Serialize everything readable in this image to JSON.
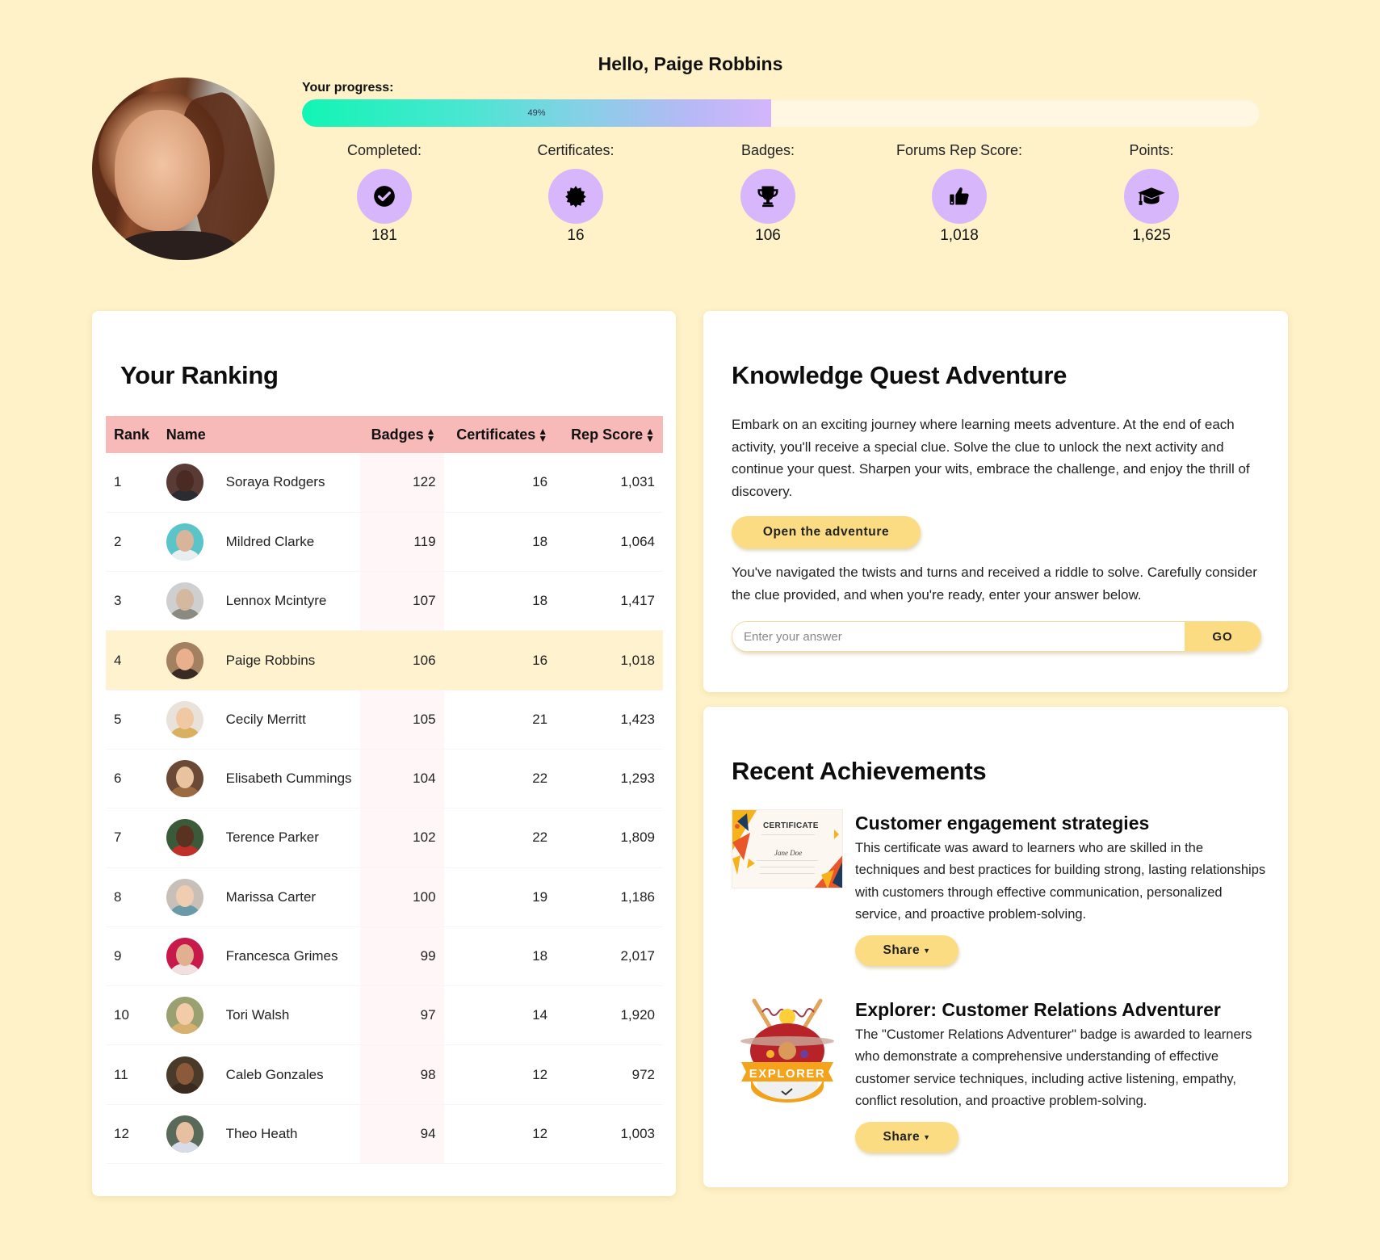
{
  "header": {
    "greeting": "Hello, Paige Robbins",
    "progress_label": "Your progress:",
    "progress_percent": 49,
    "progress_text": "49%",
    "avatar_alt": "Paige Robbins profile photo"
  },
  "stats": [
    {
      "label": "Completed:",
      "value": "181",
      "icon": "check-circle-icon"
    },
    {
      "label": "Certificates:",
      "value": "16",
      "icon": "certificate-seal-icon"
    },
    {
      "label": "Badges:",
      "value": "106",
      "icon": "trophy-icon"
    },
    {
      "label": "Forums Rep Score:",
      "value": "1,018",
      "icon": "thumbs-up-icon"
    },
    {
      "label": "Points:",
      "value": "1,625",
      "icon": "graduation-cap-icon"
    }
  ],
  "ranking": {
    "title": "Your Ranking",
    "columns": {
      "rank": "Rank",
      "name": "Name",
      "badges": "Badges",
      "certificates": "Certificates",
      "rep_score": "Rep Score"
    },
    "sort_icon": "sort-icon",
    "rows": [
      {
        "rank": "1",
        "name": "Soraya Rodgers",
        "badges": "122",
        "certificates": "16",
        "rep": "1,031"
      },
      {
        "rank": "2",
        "name": "Mildred Clarke",
        "badges": "119",
        "certificates": "18",
        "rep": "1,064"
      },
      {
        "rank": "3",
        "name": "Lennox Mcintyre",
        "badges": "107",
        "certificates": "18",
        "rep": "1,417"
      },
      {
        "rank": "4",
        "name": "Paige Robbins",
        "badges": "106",
        "certificates": "16",
        "rep": "1,018",
        "current_user": true
      },
      {
        "rank": "5",
        "name": "Cecily Merritt",
        "badges": "105",
        "certificates": "21",
        "rep": "1,423"
      },
      {
        "rank": "6",
        "name": "Elisabeth Cummings",
        "badges": "104",
        "certificates": "22",
        "rep": "1,293"
      },
      {
        "rank": "7",
        "name": "Terence Parker",
        "badges": "102",
        "certificates": "22",
        "rep": "1,809"
      },
      {
        "rank": "8",
        "name": "Marissa Carter",
        "badges": "100",
        "certificates": "19",
        "rep": "1,186"
      },
      {
        "rank": "9",
        "name": "Francesca Grimes",
        "badges": "99",
        "certificates": "18",
        "rep": "2,017"
      },
      {
        "rank": "10",
        "name": "Tori Walsh",
        "badges": "97",
        "certificates": "14",
        "rep": "1,920"
      },
      {
        "rank": "11",
        "name": "Caleb Gonzales",
        "badges": "98",
        "certificates": "12",
        "rep": "972"
      },
      {
        "rank": "12",
        "name": "Theo Heath",
        "badges": "94",
        "certificates": "12",
        "rep": "1,003"
      }
    ]
  },
  "quest": {
    "title": "Knowledge Quest Adventure",
    "intro": "Embark on an exciting journey where learning meets adventure. At the end of each activity, you'll receive a special clue. Solve the clue to unlock the next activity and continue your quest. Sharpen your wits, embrace the challenge, and enjoy the thrill of discovery.",
    "open_button": "Open the adventure",
    "riddle_text": "You've navigated the twists and turns and received a riddle to solve. Carefully consider the clue provided, and when you're ready, enter your answer below.",
    "answer_placeholder": "Enter your answer",
    "answer_value": "",
    "go_button": "GO"
  },
  "achievements": {
    "title": "Recent Achievements",
    "items": [
      {
        "name": "Customer engagement strategies",
        "description": "This certificate was award to learners who are skilled in the techniques and best practices for building strong, lasting relationships with customers through effective communication, personalized service, and proactive problem-solving.",
        "share_label": "Share",
        "thumb_title": "CERTIFICATE",
        "thumb_signature": "Jane Doe"
      },
      {
        "name": "Explorer: Customer Relations Adventurer",
        "description": "The \"Customer Relations Adventurer\" badge is awarded to learners who demonstrate a comprehensive understanding of effective customer service techniques, including active listening, empathy, conflict resolution, and proactive problem-solving.",
        "share_label": "Share",
        "thumb_banner": "EXPLORER"
      }
    ]
  },
  "colors": {
    "background": "#fff2c9",
    "accent_button": "#fbdc82",
    "stat_circle": "#d7b6fb",
    "table_header": "#f8b9b9",
    "current_user_row": "#fff2cf",
    "progress_start": "#12f5b4",
    "progress_end": "#d4b5fc"
  }
}
